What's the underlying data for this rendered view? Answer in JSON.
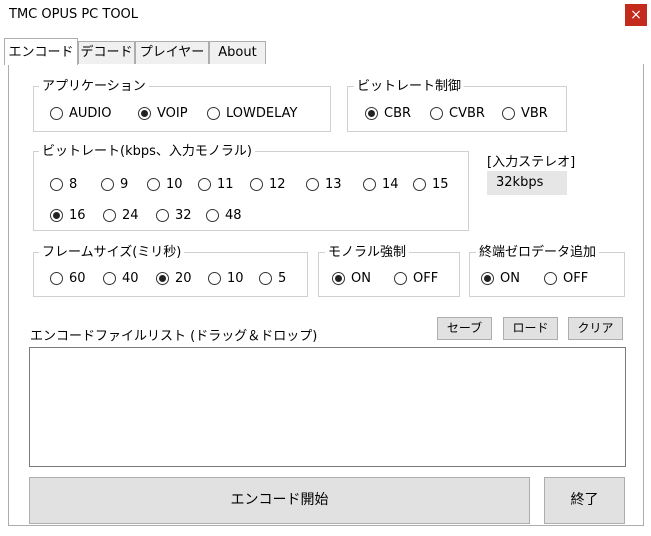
{
  "window": {
    "title": "TMC OPUS PC TOOL",
    "close_glyph": "×"
  },
  "tabs": [
    {
      "label": "エンコード",
      "active": true
    },
    {
      "label": "デコード",
      "active": false
    },
    {
      "label": "プレイヤー",
      "active": false
    },
    {
      "label": "About",
      "active": false
    }
  ],
  "application": {
    "legend": "アプリケーション",
    "options": [
      {
        "label": "AUDIO",
        "selected": false
      },
      {
        "label": "VOIP",
        "selected": true
      },
      {
        "label": "LOWDELAY",
        "selected": false
      }
    ]
  },
  "bitrate_control": {
    "legend": "ビットレート制御",
    "options": [
      {
        "label": "CBR",
        "selected": true
      },
      {
        "label": "CVBR",
        "selected": false
      },
      {
        "label": "VBR",
        "selected": false
      }
    ]
  },
  "bitrate": {
    "legend": "ビットレート(kbps、入力モノラル)",
    "options": [
      {
        "label": "8",
        "selected": false
      },
      {
        "label": "9",
        "selected": false
      },
      {
        "label": "10",
        "selected": false
      },
      {
        "label": "11",
        "selected": false
      },
      {
        "label": "12",
        "selected": false
      },
      {
        "label": "13",
        "selected": false
      },
      {
        "label": "14",
        "selected": false
      },
      {
        "label": "15",
        "selected": false
      },
      {
        "label": "16",
        "selected": true
      },
      {
        "label": "24",
        "selected": false
      },
      {
        "label": "32",
        "selected": false
      },
      {
        "label": "48",
        "selected": false
      }
    ]
  },
  "stereo": {
    "label": "[入力ステレオ]",
    "value": "32kbps"
  },
  "frame_size": {
    "legend": "フレームサイズ(ミリ秒)",
    "options": [
      {
        "label": "60",
        "selected": false
      },
      {
        "label": "40",
        "selected": false
      },
      {
        "label": "20",
        "selected": true
      },
      {
        "label": "10",
        "selected": false
      },
      {
        "label": "5",
        "selected": false
      }
    ]
  },
  "mono_force": {
    "legend": "モノラル強制",
    "options": [
      {
        "label": "ON",
        "selected": true
      },
      {
        "label": "OFF",
        "selected": false
      }
    ]
  },
  "zero_pad": {
    "legend": "終端ゼロデータ追加",
    "options": [
      {
        "label": "ON",
        "selected": true
      },
      {
        "label": "OFF",
        "selected": false
      }
    ]
  },
  "file_list": {
    "label": "エンコードファイルリスト (ドラッグ＆ドロップ)",
    "save_label": "セーブ",
    "load_label": "ロード",
    "clear_label": "クリア"
  },
  "actions": {
    "start_label": "エンコード開始",
    "exit_label": "終了"
  },
  "colors": {
    "close_bg": "#c42b1c",
    "button_bg": "#e1e1e1",
    "border": "#adadad"
  }
}
